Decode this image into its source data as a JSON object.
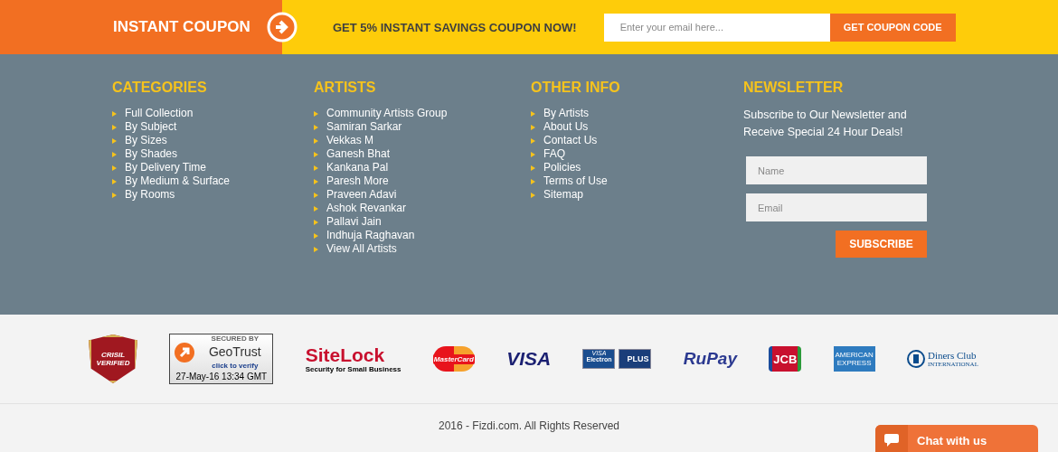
{
  "coupon_bar": {
    "title": "INSTANT COUPON",
    "offer": "GET 5% INSTANT SAVINGS COUPON NOW!",
    "email_placeholder": "Enter your email here...",
    "button": "GET COUPON CODE"
  },
  "columns": [
    {
      "heading": "CATEGORIES",
      "links": [
        "Full Collection",
        "By Subject",
        "By Sizes",
        "By Shades",
        "By Delivery Time",
        "By Medium & Surface",
        "By Rooms"
      ]
    },
    {
      "heading": "ARTISTS",
      "links": [
        "Community Artists Group",
        "Samiran Sarkar",
        "Vekkas M",
        "Ganesh Bhat",
        "Kankana Pal",
        "Paresh More",
        "Praveen Adavi",
        "Ashok Revankar",
        "Pallavi Jain",
        "Indhuja Raghavan",
        "View All Artists"
      ]
    },
    {
      "heading": "OTHER INFO",
      "links": [
        "By Artists",
        "About Us",
        "Contact Us",
        "FAQ",
        "Policies",
        "Terms of Use",
        "Sitemap"
      ]
    }
  ],
  "newsletter": {
    "heading": "NEWSLETTER",
    "text": "Subscribe to Our Newsletter and Receive Special 24 Hour Deals!",
    "name_placeholder": "Name",
    "email_placeholder": "Email",
    "button": "SUBSCRIBE"
  },
  "badges": [
    {
      "kind": "crisil",
      "lines": [
        "CRISIL",
        "VERIFIED"
      ]
    },
    {
      "kind": "geotrust",
      "lines": [
        "SECURED BY",
        "GeoTrust",
        "click to verify",
        "27-May-16 13:34 GMT"
      ]
    },
    {
      "kind": "sitelock",
      "lines": [
        "SiteLock",
        "Security for Small Business"
      ]
    },
    {
      "kind": "mastercard",
      "lines": [
        "MasterCard"
      ]
    },
    {
      "kind": "visa",
      "lines": [
        "VISA"
      ]
    },
    {
      "kind": "electron",
      "lines": [
        "VISA",
        "Electron",
        "PLUS"
      ]
    },
    {
      "kind": "rupay",
      "lines": [
        "RuPay"
      ]
    },
    {
      "kind": "jcb",
      "lines": [
        "JCB"
      ]
    },
    {
      "kind": "amex",
      "lines": [
        "AMERICAN",
        "EXPRESS"
      ]
    },
    {
      "kind": "diners",
      "lines": [
        "Diners Club",
        "INTERNATIONAL"
      ]
    }
  ],
  "copyright": "2016 - Fizdi.com. All Rights Reserved",
  "chat": {
    "label": "Chat with us"
  }
}
